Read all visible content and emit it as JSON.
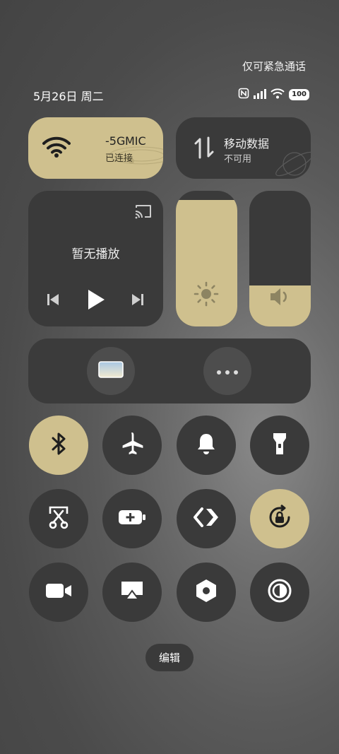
{
  "header": {
    "emergency_note": "仅可紧急通话",
    "date": "5月26日 周二",
    "battery": "100"
  },
  "wifi_tile": {
    "ssid": "-5G",
    "ssid_suffix": "MIC",
    "status": "已连接"
  },
  "mobile_tile": {
    "title": "移动数据",
    "status": "不可用"
  },
  "media": {
    "status": "暂无播放"
  },
  "sliders": {
    "brightness_level": 0.93,
    "volume_level": 0.3
  },
  "toggles": [
    {
      "name": "bluetooth",
      "icon": "bluetooth-icon",
      "active": true
    },
    {
      "name": "airplane",
      "icon": "airplane-icon",
      "active": false
    },
    {
      "name": "ringer",
      "icon": "bell-icon",
      "active": false
    },
    {
      "name": "flashlight",
      "icon": "flashlight-icon",
      "active": false
    },
    {
      "name": "screenshot",
      "icon": "scissors-icon",
      "active": false
    },
    {
      "name": "battery-saver",
      "icon": "battery-plus-icon",
      "active": false
    },
    {
      "name": "connect",
      "icon": "code-icon",
      "active": false
    },
    {
      "name": "rotation-lock",
      "icon": "rotation-lock-icon",
      "active": true
    },
    {
      "name": "screen-record",
      "icon": "video-icon",
      "active": false
    },
    {
      "name": "cast-screen",
      "icon": "airplay-icon",
      "active": false
    },
    {
      "name": "settings",
      "icon": "hexagon-icon",
      "active": false
    },
    {
      "name": "dark-mode",
      "icon": "contrast-icon",
      "active": false
    }
  ],
  "edit_label": "编辑",
  "colors": {
    "accent": "#cfc08e",
    "tile_dark": "#3a3a3a"
  }
}
